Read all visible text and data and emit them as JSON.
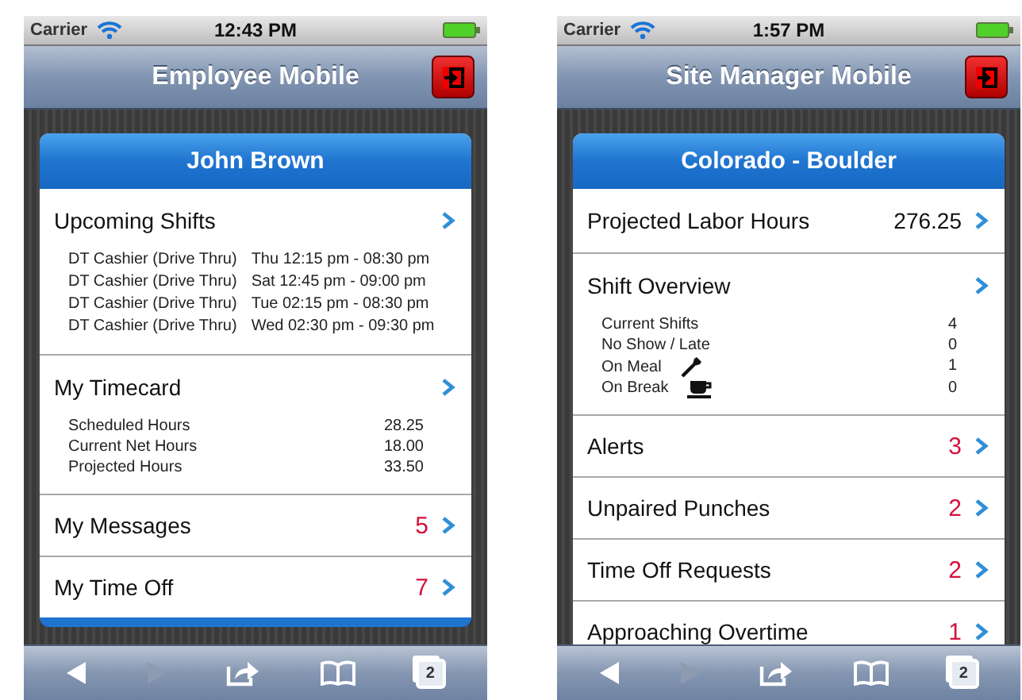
{
  "phones": [
    {
      "status": {
        "carrier": "Carrier",
        "time": "12:43 PM"
      },
      "title": "Employee Mobile",
      "card_title": "John Brown",
      "sections": [
        {
          "kind": "schedule",
          "title": "Upcoming Shifts",
          "rows": [
            {
              "kind": "plain",
              "label": "DT Cashier (Drive Thru)",
              "value": "Thu 12:15 pm - 08:30 pm"
            },
            {
              "kind": "plain",
              "label": "DT Cashier (Drive Thru)",
              "value": "Sat 12:45 pm - 09:00 pm"
            },
            {
              "kind": "plain",
              "label": "DT Cashier (Drive Thru)",
              "value": "Tue 02:15 pm - 08:30 pm"
            },
            {
              "kind": "plain",
              "label": "DT Cashier (Drive Thru)",
              "value": "Wed 02:30 pm - 09:30 pm"
            }
          ]
        },
        {
          "kind": "totals",
          "title": "My Timecard",
          "rows": [
            {
              "kind": "plain",
              "label": "Scheduled Hours",
              "value": "28.25"
            },
            {
              "kind": "plain",
              "label": "Current Net Hours",
              "value": "18.00"
            },
            {
              "kind": "plain",
              "label": "Projected Hours",
              "value": "33.50"
            }
          ]
        },
        {
          "kind": "count",
          "title": "My Messages",
          "count": "5"
        },
        {
          "kind": "count",
          "title": "My Time Off",
          "count": "7"
        }
      ],
      "card_footer": true,
      "toolbar": [
        {
          "kind": "back",
          "disabled": false
        },
        {
          "kind": "forward",
          "disabled": true
        },
        {
          "kind": "share",
          "disabled": false
        },
        {
          "kind": "bookmarks",
          "disabled": false
        },
        {
          "kind": "tabs",
          "disabled": false,
          "count": "2"
        }
      ]
    },
    {
      "status": {
        "carrier": "Carrier",
        "time": "1:57 PM"
      },
      "title": "Site Manager Mobile",
      "card_title": "Colorado - Boulder",
      "sections": [
        {
          "kind": "value",
          "title": "Projected Labor Hours",
          "value": "276.25"
        },
        {
          "kind": "totals",
          "title": "Shift Overview",
          "rows": [
            {
              "kind": "plain",
              "label": "Current Shifts",
              "value": "4"
            },
            {
              "kind": "plain",
              "label": "No Show / Late",
              "value": "0"
            },
            {
              "kind": "meal",
              "label": "On Meal",
              "value": "1"
            },
            {
              "kind": "break",
              "label": "On Break",
              "value": "0"
            }
          ]
        },
        {
          "kind": "count",
          "title": "Alerts",
          "count": "3"
        },
        {
          "kind": "count",
          "title": "Unpaired Punches",
          "count": "2"
        },
        {
          "kind": "count",
          "title": "Time Off Requests",
          "count": "2"
        },
        {
          "kind": "count",
          "title": "Approaching Overtime",
          "count": "1"
        }
      ],
      "card_footer": false,
      "toolbar": [
        {
          "kind": "back",
          "disabled": false
        },
        {
          "kind": "forward",
          "disabled": true
        },
        {
          "kind": "share",
          "disabled": false
        },
        {
          "kind": "bookmarks",
          "disabled": false
        },
        {
          "kind": "tabs",
          "disabled": false,
          "count": "2"
        }
      ]
    }
  ]
}
